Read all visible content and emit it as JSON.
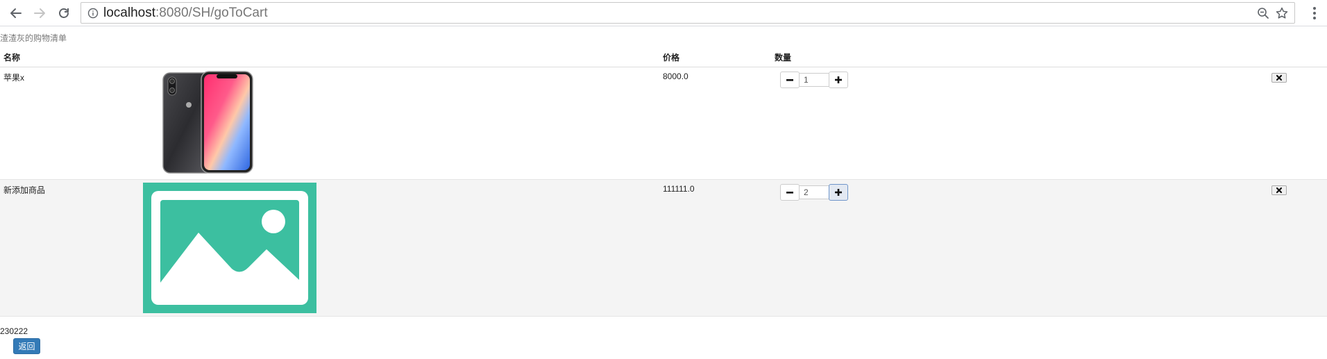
{
  "browser": {
    "url_host": "localhost",
    "url_path": ":8080/SH/goToCart",
    "icons": {
      "back": "arrow-left-icon",
      "forward": "arrow-right-icon",
      "reload": "reload-icon",
      "info": "info-icon",
      "zoom": "zoom-out-icon",
      "bookmark": "star-icon",
      "menu": "kebab-menu-icon"
    }
  },
  "page": {
    "caption": "渣渣灰的购物清单",
    "columns": {
      "name": "名称",
      "price": "价格",
      "quantity": "数量"
    },
    "items": [
      {
        "name": "苹果x",
        "price": "8000.0",
        "quantity": "1",
        "image": "iphone-x-photo"
      },
      {
        "name": "新添加商品",
        "price": "111111.0",
        "quantity": "2",
        "image": "image-placeholder-icon"
      }
    ],
    "total": "230222",
    "back_label": "返回"
  },
  "colors": {
    "placeholder_green": "#3cbfa0",
    "primary_button": "#337ab7",
    "row_alt": "#f4f4f4"
  }
}
